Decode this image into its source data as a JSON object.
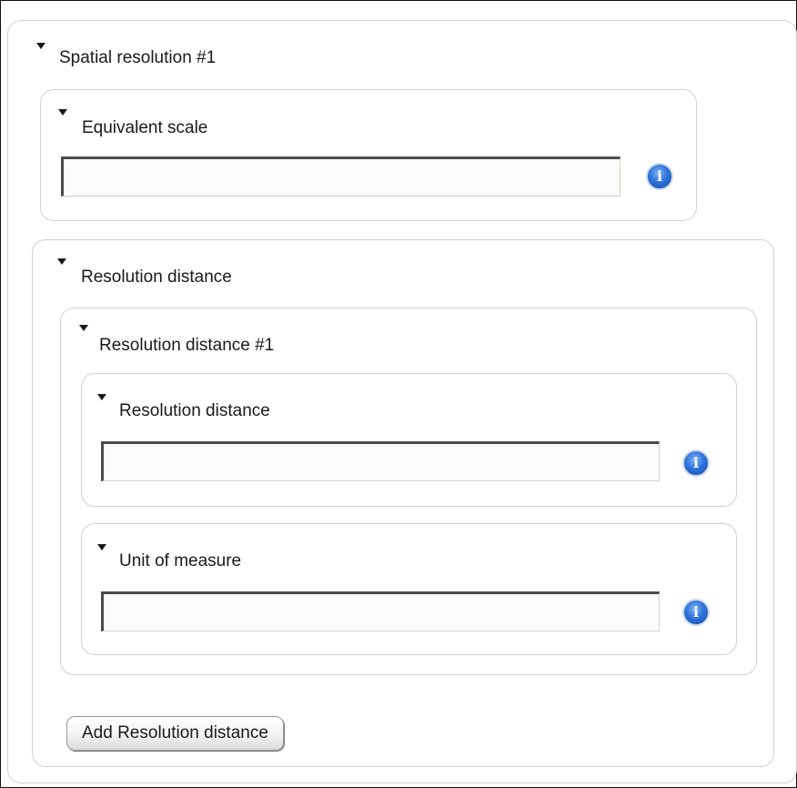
{
  "spatial_resolution": {
    "title": "Spatial resolution #1",
    "equivalent_scale": {
      "title": "Equivalent scale",
      "value": "",
      "info_icon": "info-icon",
      "info_glyph": "i"
    },
    "resolution_distance": {
      "title": "Resolution distance",
      "item": {
        "title": "Resolution distance #1",
        "distance": {
          "title": "Resolution distance",
          "value": "",
          "info_glyph": "i"
        },
        "unit": {
          "title": "Unit of measure",
          "value": "",
          "info_glyph": "i"
        }
      },
      "add_button_label": "Add Resolution distance"
    }
  },
  "colors": {
    "panel_border": "#d0d0d0",
    "info_blue": "#2f74dc"
  }
}
